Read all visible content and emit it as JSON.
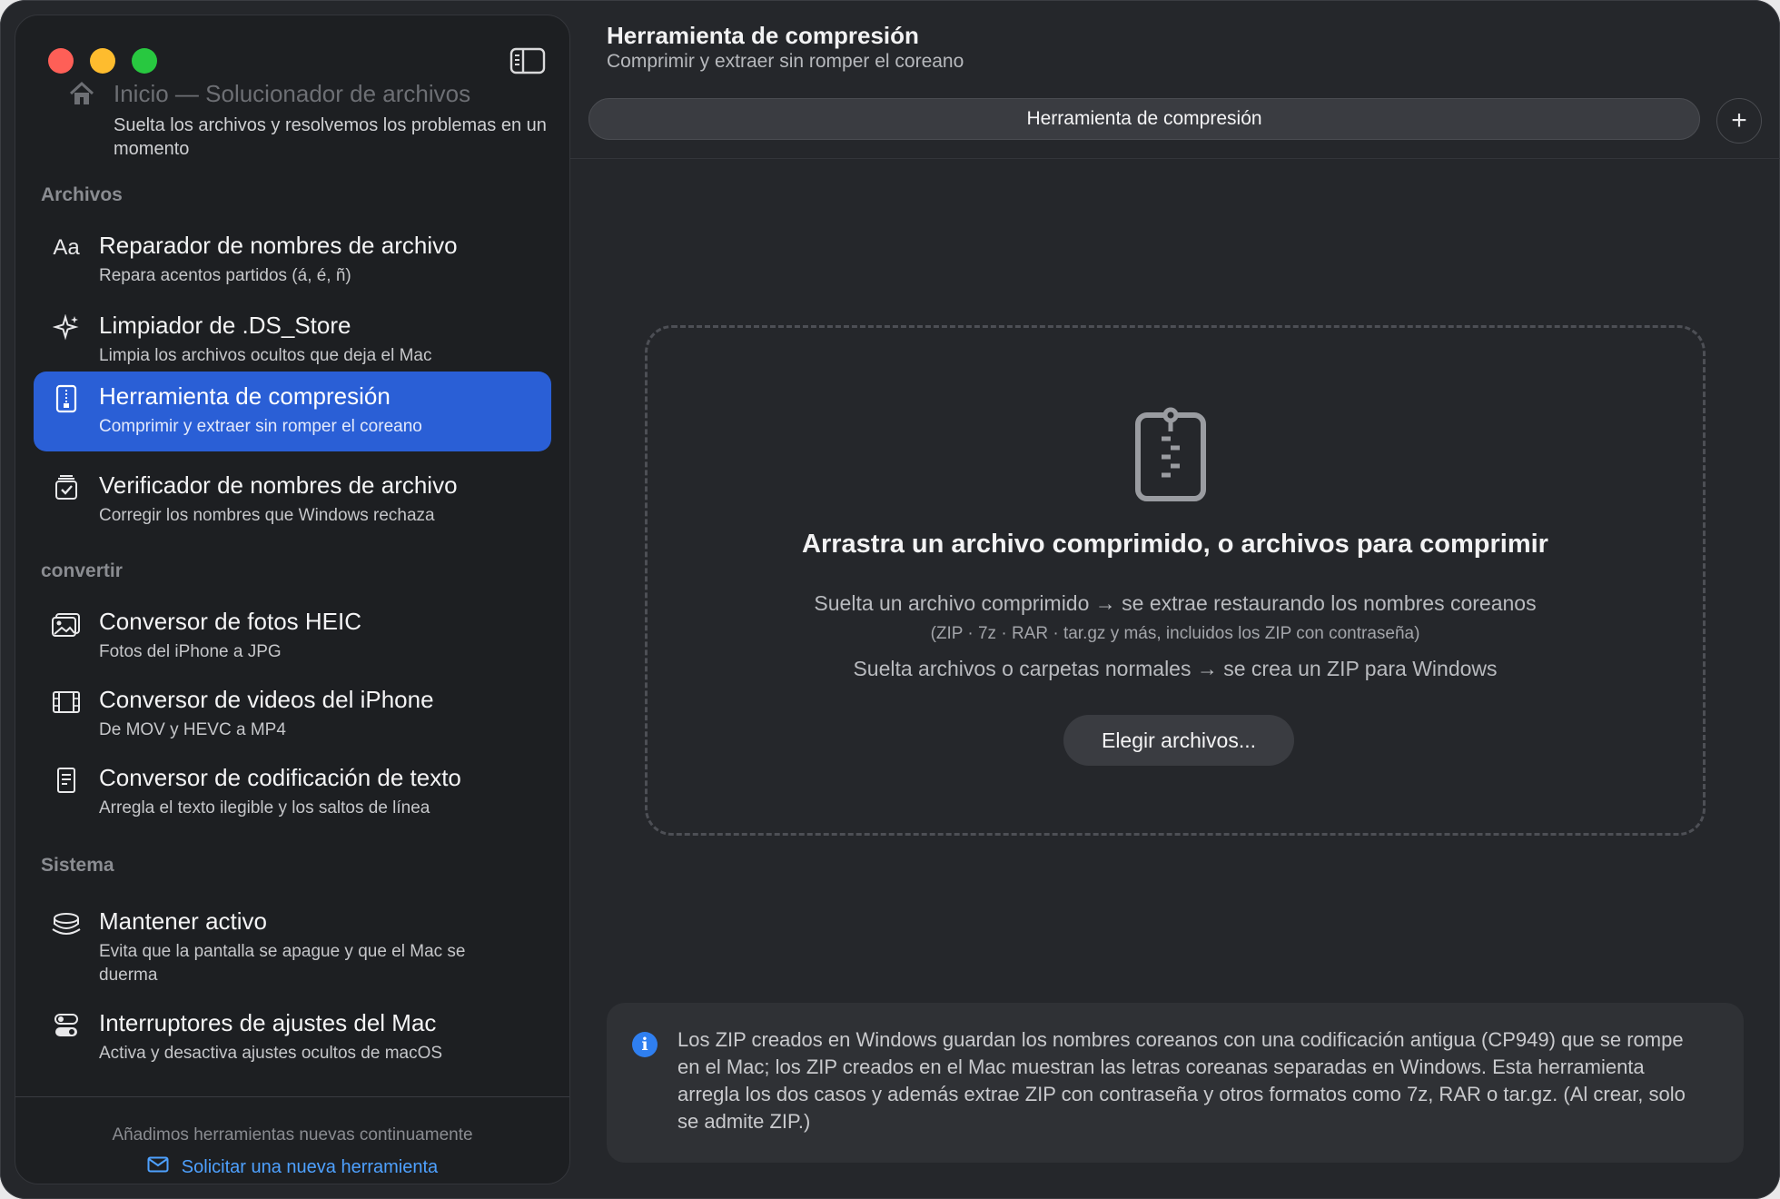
{
  "sidebar": {
    "home": {
      "title": "Inicio — Solucionador de archivos",
      "subtitle": "Suelta los archivos y resolvemos los problemas en un momento"
    },
    "sections": {
      "archivos": "Archivos",
      "convertir": "convertir",
      "sistema": "Sistema"
    },
    "items": [
      {
        "icon": "text-case-icon",
        "title": "Reparador de nombres de archivo",
        "subtitle": "Repara acentos partidos (á, é, ñ)"
      },
      {
        "icon": "sparkles-icon",
        "title": "Limpiador de .DS_Store",
        "subtitle": "Limpia los archivos ocultos que deja el Mac"
      },
      {
        "icon": "zip-file-icon",
        "title": "Herramienta de compresión",
        "subtitle": "Comprimir y extraer sin romper el coreano",
        "active": true
      },
      {
        "icon": "checkbox-tray-icon",
        "title": "Verificador de nombres de archivo",
        "subtitle": "Corregir los nombres que Windows rechaza"
      },
      {
        "icon": "photos-icon",
        "title": "Conversor de fotos HEIC",
        "subtitle": "Fotos del iPhone a JPG"
      },
      {
        "icon": "film-icon",
        "title": "Conversor de videos del iPhone",
        "subtitle": "De MOV y HEVC a MP4"
      },
      {
        "icon": "document-icon",
        "title": "Conversor de codificación de texto",
        "subtitle": "Arregla el texto ilegible y los saltos de línea"
      },
      {
        "icon": "coffee-cup-icon",
        "title": "Mantener activo",
        "subtitle": "Evita que la pantalla se apague y que el Mac se duerma"
      },
      {
        "icon": "toggles-icon",
        "title": "Interruptores de ajustes del Mac",
        "subtitle": "Activa y desactiva ajustes ocultos de macOS"
      }
    ],
    "footer": {
      "note": "Añadimos herramientas nuevas continuamente",
      "link": "Solicitar una nueva herramienta"
    }
  },
  "main": {
    "title": "Herramienta de compresión",
    "subtitle": "Comprimir y extraer sin romper el coreano",
    "tab_label": "Herramienta de compresión",
    "add_tab": "+",
    "dropzone": {
      "title": "Arrastra un archivo comprimido, o archivos para comprimir",
      "line1": "Suelta un archivo comprimido → se extrae restaurando los nombres coreanos",
      "line2": "(ZIP · 7z · RAR · tar.gz y más, incluidos los ZIP con contraseña)",
      "line3": "Suelta archivos o carpetas normales → se crea un ZIP para Windows",
      "button": "Elegir archivos..."
    },
    "info": {
      "icon": "i",
      "text": "Los ZIP creados en Windows guardan los nombres coreanos con una codificación antigua (CP949) que se rompe en el Mac; los ZIP creados en el Mac muestran las letras coreanas separadas en Windows. Esta herramienta arregla los dos casos y además extrae ZIP con contraseña y otros formatos como 7z, RAR o tar.gz. (Al crear, solo se admite ZIP.)"
    }
  },
  "colors": {
    "accent": "#2a5fd6",
    "link": "#4ea1ff",
    "info": "#2f7ff0"
  }
}
